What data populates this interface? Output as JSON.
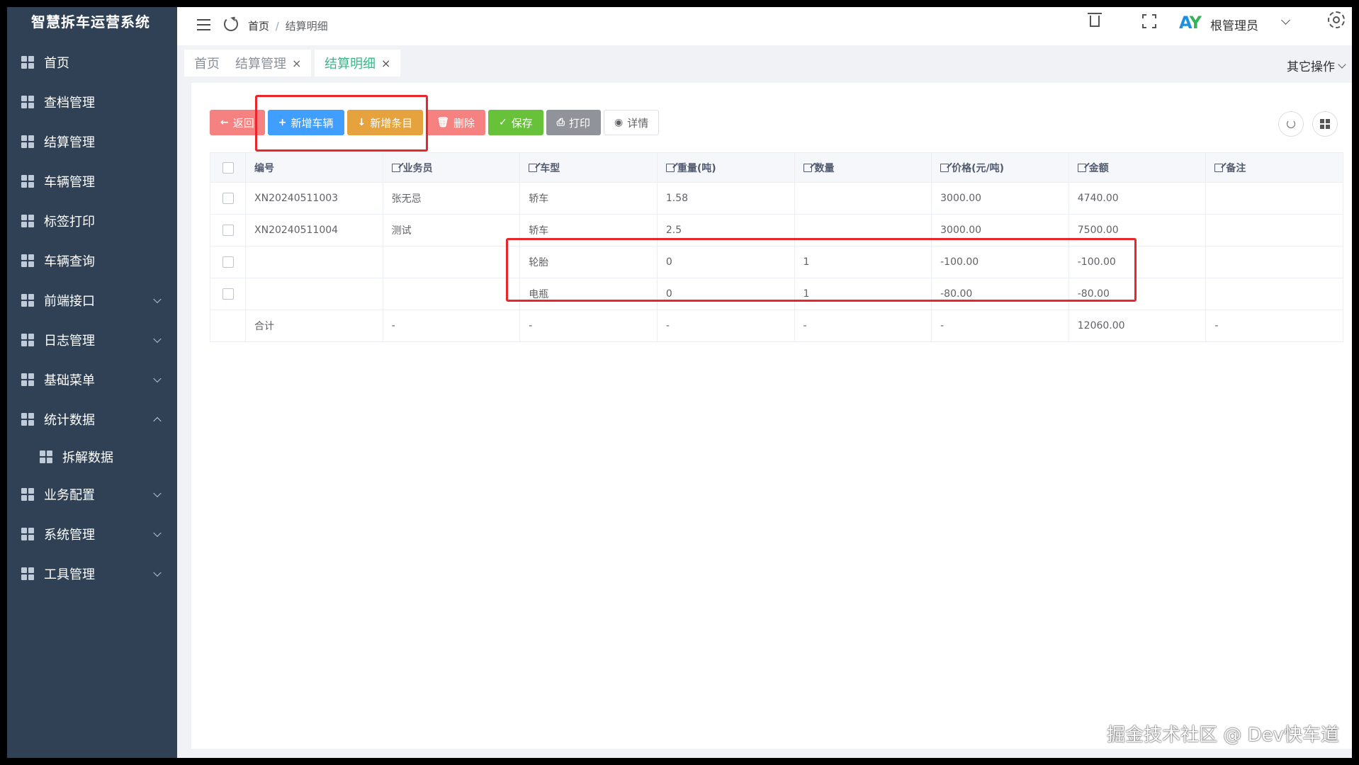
{
  "app": {
    "brand": "智慧拆车运营系统"
  },
  "sidebar": {
    "items": [
      {
        "label": "首页",
        "expandable": false
      },
      {
        "label": "查档管理",
        "expandable": false
      },
      {
        "label": "结算管理",
        "expandable": false
      },
      {
        "label": "车辆管理",
        "expandable": false
      },
      {
        "label": "标签打印",
        "expandable": false
      },
      {
        "label": "车辆查询",
        "expandable": false
      },
      {
        "label": "前端接口",
        "expandable": true
      },
      {
        "label": "日志管理",
        "expandable": true
      },
      {
        "label": "基础菜单",
        "expandable": true
      },
      {
        "label": "统计数据",
        "expandable": true,
        "expanded": true
      },
      {
        "label": "拆解数据",
        "submenu": true
      },
      {
        "label": "业务配置",
        "expandable": true
      },
      {
        "label": "系统管理",
        "expandable": true
      },
      {
        "label": "工具管理",
        "expandable": true
      }
    ]
  },
  "header": {
    "breadcrumb": [
      "首页",
      "结算明细"
    ],
    "breadcrumb_sep": "/",
    "logo_text_a": "A",
    "logo_text_b": "Y",
    "user": "根管理员"
  },
  "tabs": {
    "items": [
      {
        "label": "首页",
        "closable": false,
        "active": false
      },
      {
        "label": "结算管理",
        "closable": true,
        "active": false
      },
      {
        "label": "结算明细",
        "closable": true,
        "active": true
      }
    ],
    "close_glyph": "×",
    "other_ops": "其它操作"
  },
  "toolbar": {
    "back": "返回",
    "add_vehicle": "新增车辆",
    "add_item": "新增条目",
    "delete": "删除",
    "save": "保存",
    "print": "打印",
    "detail": "详情"
  },
  "table": {
    "columns": [
      "编号",
      "业务员",
      "车型",
      "重量(吨)",
      "数量",
      "价格(元/吨)",
      "金额",
      "备注"
    ],
    "rows": [
      [
        "XN20240511003",
        "张无忌",
        "轿车",
        "1.58",
        "",
        "3000.00",
        "4740.00",
        ""
      ],
      [
        "XN20240511004",
        "测试",
        "轿车",
        "2.5",
        "",
        "3000.00",
        "7500.00",
        ""
      ],
      [
        "",
        "",
        "轮胎",
        "0",
        "1",
        "-100.00",
        "-100.00",
        ""
      ],
      [
        "",
        "",
        "电瓶",
        "0",
        "1",
        "-80.00",
        "-80.00",
        ""
      ]
    ],
    "summary": [
      "合计",
      "-",
      "-",
      "-",
      "-",
      "-",
      "12060.00",
      "-"
    ]
  },
  "colors": {
    "sidebar_bg": "#304156",
    "active_tab": "#3bb68a",
    "primary": "#409eff",
    "warning": "#e6a23c",
    "danger": "#f56c6c",
    "success": "#67c23a",
    "info": "#909399",
    "annotation": "#e8262b"
  },
  "watermark": "掘金技术社区 @ Dev快车道"
}
